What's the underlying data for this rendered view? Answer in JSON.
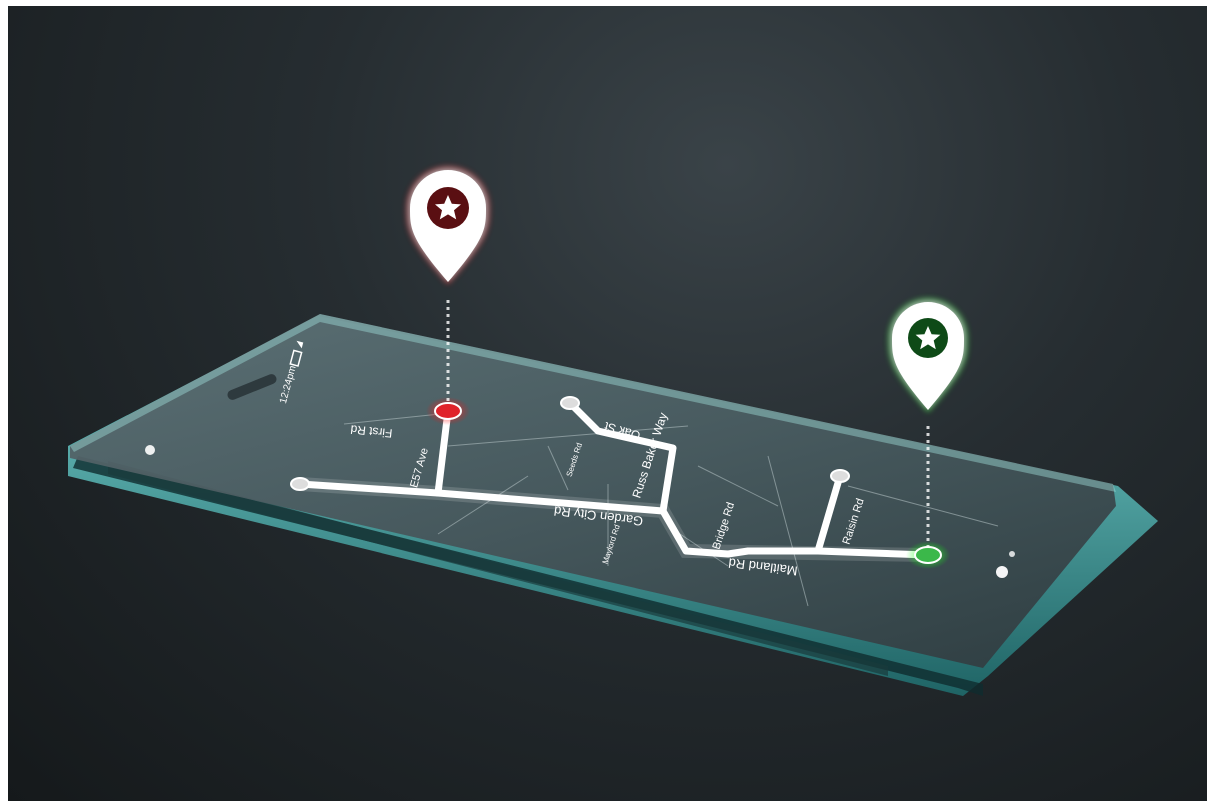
{
  "status_bar": {
    "time": "12:24pm"
  },
  "streets": {
    "first_rd": "First Rd",
    "e57_ave": "E57 Ave",
    "oak_st": "Oak St",
    "seeds_rd": "Seeds Rd",
    "russ_baker_way": "Russ Baker Way",
    "garden_city_rd": "Garden City Rd",
    "bridge_rd": "Bridge Rd",
    "maitland_rd": "Maitland Rd",
    "raisin_rd": "Raisin Rd",
    "maylord_rd": "Maylord Rd"
  },
  "pins": {
    "start": {
      "icon": "star-icon",
      "color": "#e0232b"
    },
    "end": {
      "icon": "star-icon",
      "color": "#3bb84a"
    }
  },
  "colors": {
    "route": "#ffffff",
    "glass_edge": "#6fd8d8",
    "screen": "#4a5a60"
  }
}
